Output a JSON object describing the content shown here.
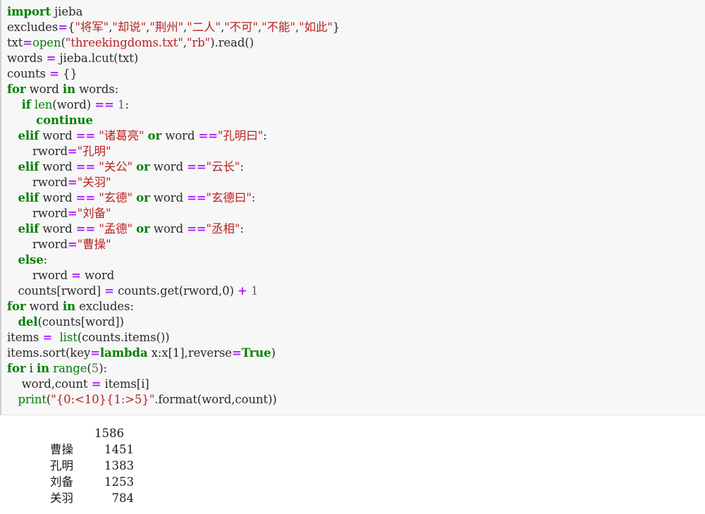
{
  "cell": {
    "type": "python-code-cell",
    "background_color": "#f7f7f7",
    "border_color": "#cfcfcf",
    "code_lines": [
      "import jieba",
      "excludes={\"将军\",\"却说\",\"荆州\",\"二人\",\"不可\",\"不能\",\"如此\"}",
      "txt=open(\"threekingdoms.txt\",\"rb\").read()",
      "words = jieba.lcut(txt)",
      "counts = {}",
      "for word in words:",
      "    if len(word) == 1:",
      "        continue",
      "    elif word == \"诸葛亮\" or word ==\"孔明曰\":",
      "        rword=\"孔明\"",
      "    elif word == \"关公\" or word ==\"云长\":",
      "        rword=\"关羽\"",
      "    elif word == \"玄德\" or word ==\"玄德曰\":",
      "        rword=\"刘备\"",
      "    elif word == \"孟德\" or word ==\"丞相\":",
      "        rword=\"曹操\"",
      "    else:",
      "        rword = word",
      "    counts[rword] = counts.get(rword,0) + 1",
      "for word in excludes:",
      "    del(counts[word])",
      "items =  list(counts.items())",
      "items.sort(key=lambda x:x[1],reverse=True)",
      "for i in range(5):",
      "    word,count = items[i]",
      "    print(\"{0:<10}{1:>5}\".format(word,count))"
    ],
    "tokens": {
      "line1": {
        "kw_import": "import",
        "name_jieba": "jieba"
      },
      "line2": {
        "name": "excludes",
        "op_eq": "=",
        "brace_open": "{",
        "strings": [
          "\"将军\"",
          "\"却说\"",
          "\"荆州\"",
          "\"二人\"",
          "\"不可\"",
          "\"不能\"",
          "\"如此\""
        ],
        "comma": ",",
        "brace_close": "}"
      },
      "line3": {
        "name": "txt",
        "op_eq": "=",
        "builtin_open": "open",
        "paren_open": "(",
        "str_filename": "\"threekingdoms.txt\"",
        "comma": ",",
        "str_mode": "\"rb\"",
        "paren_close": ")",
        "dot_read": ".read()"
      },
      "line4": {
        "name": "words",
        "op_eq": "=",
        "call": "jieba.lcut(txt)"
      },
      "line5": {
        "name": "counts",
        "op_eq": "=",
        "empty_dict": "{}"
      },
      "line6": {
        "kw_for": "for",
        "var": "word",
        "kw_in": "in",
        "iter": "words",
        "colon": ":"
      },
      "line7": {
        "kw_if": "if",
        "builtin_len": "len",
        "args": "(word)",
        "op_eqeq": "==",
        "num": "1",
        "colon": ":"
      },
      "line8": {
        "kw_continue": "continue"
      },
      "line9": {
        "kw_elif": "elif",
        "var": "word",
        "op_eqeq": "==",
        "str_a": "\"诸葛亮\"",
        "kw_or": "or",
        "var2": "word",
        "op_eqeq2": "==",
        "str_b": "\"孔明曰\"",
        "colon": ":"
      },
      "line10": {
        "name": "rword",
        "op_eq": "=",
        "str_val": "\"孔明\""
      },
      "line11": {
        "kw_elif": "elif",
        "var": "word",
        "op_eqeq": "==",
        "str_a": "\"关公\"",
        "kw_or": "or",
        "var2": "word",
        "op_eqeq2": "==",
        "str_b": "\"云长\"",
        "colon": ":"
      },
      "line12": {
        "name": "rword",
        "op_eq": "=",
        "str_val": "\"关羽\""
      },
      "line13": {
        "kw_elif": "elif",
        "var": "word",
        "op_eqeq": "==",
        "str_a": "\"玄德\"",
        "kw_or": "or",
        "var2": "word",
        "op_eqeq2": "==",
        "str_b": "\"玄德曰\"",
        "colon": ":"
      },
      "line14": {
        "name": "rword",
        "op_eq": "=",
        "str_val": "\"刘备\""
      },
      "line15": {
        "kw_elif": "elif",
        "var": "word",
        "op_eqeq": "==",
        "str_a": "\"孟德\"",
        "kw_or": "or",
        "var2": "word",
        "op_eqeq2": "==",
        "str_b": "\"丞相\"",
        "colon": ":"
      },
      "line16": {
        "name": "rword",
        "op_eq": "=",
        "str_val": "\"曹操\""
      },
      "line17": {
        "kw_else": "else",
        "colon": ":"
      },
      "line18": {
        "name": "rword",
        "op_eq": "=",
        "value": "word"
      },
      "line19": {
        "target": "counts[rword]",
        "op_eq": "=",
        "call": "counts.get(rword,0)",
        "op_plus": "+",
        "num": "1"
      },
      "line20": {
        "kw_for": "for",
        "var": "word",
        "kw_in": "in",
        "iter": "excludes",
        "colon": ":"
      },
      "line21": {
        "kw_del": "del",
        "args": "(counts[word])"
      },
      "line22": {
        "name": "items",
        "op_eq": "=",
        "builtin_list": "list",
        "args": "(counts.items())"
      },
      "line23": {
        "call": "items.sort",
        "key_arg": "key",
        "op_eq": "=",
        "kw_lambda": "lambda",
        "lambda_body": "x:x[1]",
        "reverse_arg": "reverse",
        "op_eq2": "=",
        "kw_true": "True"
      },
      "line24": {
        "kw_for": "for",
        "var": "i",
        "kw_in": "in",
        "builtin_range": "range",
        "num": "5",
        "colon": ":"
      },
      "line25": {
        "targets": "word,count",
        "op_eq": "=",
        "source": "items[i]"
      },
      "line26": {
        "builtin_print": "print",
        "fmt_string": "\"{0:<10}{1:>5}\"",
        "method": ".format",
        "args": "(word,count)"
      }
    }
  },
  "output": {
    "rows": [
      {
        "word": "",
        "count": "1586"
      },
      {
        "word": "曹操",
        "count": "1451"
      },
      {
        "word": "孔明",
        "count": "1383"
      },
      {
        "word": "刘备",
        "count": "1253"
      },
      {
        "word": "关羽",
        "count": "784"
      }
    ]
  },
  "colors": {
    "keyword": "#008000",
    "string": "#ba2121",
    "operator": "#aa22ff",
    "builtin": "#008000",
    "number": "#666666",
    "text": "#2b2b2b",
    "cell_background": "#f7f7f7",
    "output_background": "#ffffff"
  }
}
